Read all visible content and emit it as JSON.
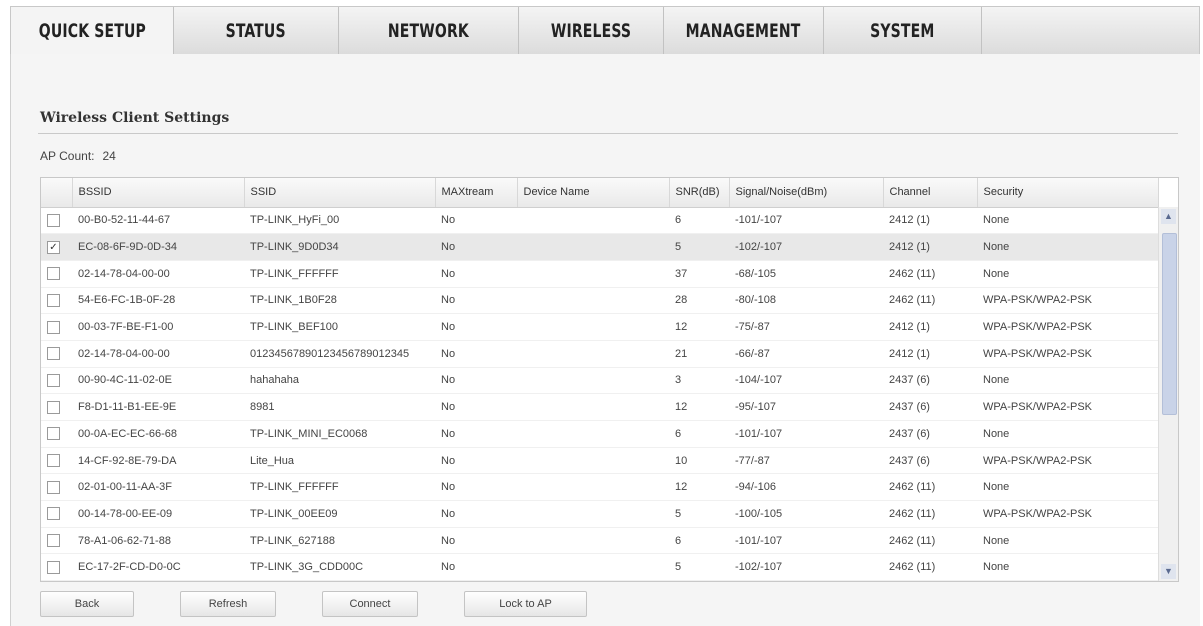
{
  "tabs": [
    "QUICK SETUP",
    "STATUS",
    "NETWORK",
    "WIRELESS",
    "MANAGEMENT",
    "SYSTEM"
  ],
  "section": {
    "title": "Wireless Client Settings"
  },
  "ap_count": {
    "label": "AP Count:",
    "value": "24"
  },
  "table": {
    "headers": [
      "BSSID",
      "SSID",
      "MAXtream",
      "Device Name",
      "SNR(dB)",
      "Signal/Noise(dBm)",
      "Channel",
      "Security"
    ],
    "rows": [
      {
        "checked": false,
        "bssid": "00-B0-52-11-44-67",
        "ssid": "TP-LINK_HyFi_00",
        "maxtream": "No",
        "device": "",
        "snr": "6",
        "signal": "-101/-107",
        "channel": "2412 (1)",
        "security": "None"
      },
      {
        "checked": true,
        "bssid": "EC-08-6F-9D-0D-34",
        "ssid": "TP-LINK_9D0D34",
        "maxtream": "No",
        "device": "",
        "snr": "5",
        "signal": "-102/-107",
        "channel": "2412 (1)",
        "security": "None"
      },
      {
        "checked": false,
        "bssid": "02-14-78-04-00-00",
        "ssid": "TP-LINK_FFFFFF",
        "maxtream": "No",
        "device": "",
        "snr": "37",
        "signal": "-68/-105",
        "channel": "2462 (11)",
        "security": "None"
      },
      {
        "checked": false,
        "bssid": "54-E6-FC-1B-0F-28",
        "ssid": "TP-LINK_1B0F28",
        "maxtream": "No",
        "device": "",
        "snr": "28",
        "signal": "-80/-108",
        "channel": "2462 (11)",
        "security": "WPA-PSK/WPA2-PSK"
      },
      {
        "checked": false,
        "bssid": "00-03-7F-BE-F1-00",
        "ssid": "TP-LINK_BEF100",
        "maxtream": "No",
        "device": "",
        "snr": "12",
        "signal": "-75/-87",
        "channel": "2412 (1)",
        "security": "WPA-PSK/WPA2-PSK"
      },
      {
        "checked": false,
        "bssid": "02-14-78-04-00-00",
        "ssid": "01234567890123456789012345",
        "maxtream": "No",
        "device": "",
        "snr": "21",
        "signal": "-66/-87",
        "channel": "2412 (1)",
        "security": "WPA-PSK/WPA2-PSK"
      },
      {
        "checked": false,
        "bssid": "00-90-4C-11-02-0E",
        "ssid": "hahahaha",
        "maxtream": "No",
        "device": "",
        "snr": "3",
        "signal": "-104/-107",
        "channel": "2437 (6)",
        "security": "None"
      },
      {
        "checked": false,
        "bssid": "F8-D1-11-B1-EE-9E",
        "ssid": "8981",
        "maxtream": "No",
        "device": "",
        "snr": "12",
        "signal": "-95/-107",
        "channel": "2437 (6)",
        "security": "WPA-PSK/WPA2-PSK"
      },
      {
        "checked": false,
        "bssid": "00-0A-EC-EC-66-68",
        "ssid": "TP-LINK_MINI_EC0068",
        "maxtream": "No",
        "device": "",
        "snr": "6",
        "signal": "-101/-107",
        "channel": "2437 (6)",
        "security": "None"
      },
      {
        "checked": false,
        "bssid": "14-CF-92-8E-79-DA",
        "ssid": "Lite_Hua",
        "maxtream": "No",
        "device": "",
        "snr": "10",
        "signal": "-77/-87",
        "channel": "2437 (6)",
        "security": "WPA-PSK/WPA2-PSK"
      },
      {
        "checked": false,
        "bssid": "02-01-00-11-AA-3F",
        "ssid": "TP-LINK_FFFFFF",
        "maxtream": "No",
        "device": "",
        "snr": "12",
        "signal": "-94/-106",
        "channel": "2462 (11)",
        "security": "None"
      },
      {
        "checked": false,
        "bssid": "00-14-78-00-EE-09",
        "ssid": "TP-LINK_00EE09",
        "maxtream": "No",
        "device": "",
        "snr": "5",
        "signal": "-100/-105",
        "channel": "2462 (11)",
        "security": "WPA-PSK/WPA2-PSK"
      },
      {
        "checked": false,
        "bssid": "78-A1-06-62-71-88",
        "ssid": "TP-LINK_627188",
        "maxtream": "No",
        "device": "",
        "snr": "6",
        "signal": "-101/-107",
        "channel": "2462 (11)",
        "security": "None"
      },
      {
        "checked": false,
        "bssid": "EC-17-2F-CD-D0-0C",
        "ssid": "TP-LINK_3G_CDD00C",
        "maxtream": "No",
        "device": "",
        "snr": "5",
        "signal": "-102/-107",
        "channel": "2462 (11)",
        "security": "None"
      }
    ]
  },
  "buttons": {
    "back": "Back",
    "refresh": "Refresh",
    "connect": "Connect",
    "lock": "Lock to AP"
  },
  "icons": {
    "scroll_up": "scroll-up-arrow-icon",
    "scroll_down": "scroll-down-arrow-icon",
    "checkbox_checked": "checkmark-icon"
  }
}
